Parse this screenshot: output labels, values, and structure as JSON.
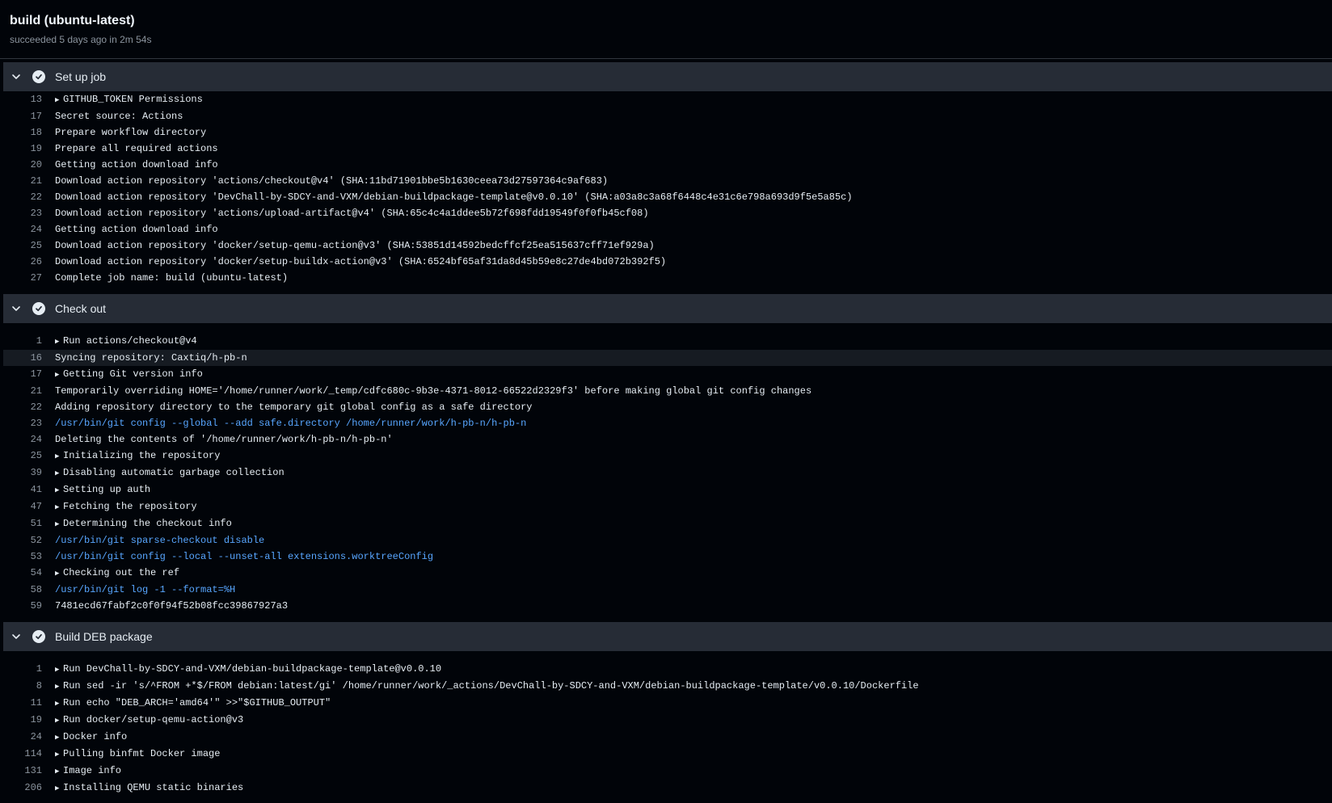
{
  "job": {
    "title": "build (ubuntu-latest)",
    "subtitle": "succeeded 5 days ago in 2m 54s"
  },
  "steps": [
    {
      "name": "Set up job",
      "lines": [
        {
          "n": "13",
          "t": "GITHUB_TOKEN Permissions",
          "group": true
        },
        {
          "n": "17",
          "t": "Secret source: Actions"
        },
        {
          "n": "18",
          "t": "Prepare workflow directory"
        },
        {
          "n": "19",
          "t": "Prepare all required actions"
        },
        {
          "n": "20",
          "t": "Getting action download info"
        },
        {
          "n": "21",
          "t": "Download action repository 'actions/checkout@v4' (SHA:11bd71901bbe5b1630ceea73d27597364c9af683)"
        },
        {
          "n": "22",
          "t": "Download action repository 'DevChall-by-SDCY-and-VXM/debian-buildpackage-template@v0.0.10' (SHA:a03a8c3a68f6448c4e31c6e798a693d9f5e5a85c)"
        },
        {
          "n": "23",
          "t": "Download action repository 'actions/upload-artifact@v4' (SHA:65c4c4a1ddee5b72f698fdd19549f0f0fb45cf08)"
        },
        {
          "n": "24",
          "t": "Getting action download info"
        },
        {
          "n": "25",
          "t": "Download action repository 'docker/setup-qemu-action@v3' (SHA:53851d14592bedcffcf25ea515637cff71ef929a)"
        },
        {
          "n": "26",
          "t": "Download action repository 'docker/setup-buildx-action@v3' (SHA:6524bf65af31da8d45b59e8c27de4bd072b392f5)"
        },
        {
          "n": "27",
          "t": "Complete job name: build (ubuntu-latest)"
        }
      ]
    },
    {
      "name": "Check out",
      "lines": [
        {
          "n": "1",
          "t": "Run actions/checkout@v4",
          "group": true
        },
        {
          "n": "16",
          "t": "Syncing repository: Caxtiq/h-pb-n",
          "hl": true
        },
        {
          "n": "17",
          "t": "Getting Git version info",
          "group": true
        },
        {
          "n": "21",
          "t": "Temporarily overriding HOME='/home/runner/work/_temp/cdfc680c-9b3e-4371-8012-66522d2329f3' before making global git config changes"
        },
        {
          "n": "22",
          "t": "Adding repository directory to the temporary git global config as a safe directory"
        },
        {
          "n": "23",
          "t": "/usr/bin/git config --global --add safe.directory /home/runner/work/h-pb-n/h-pb-n",
          "cmd": true
        },
        {
          "n": "24",
          "t": "Deleting the contents of '/home/runner/work/h-pb-n/h-pb-n'"
        },
        {
          "n": "25",
          "t": "Initializing the repository",
          "group": true
        },
        {
          "n": "39",
          "t": "Disabling automatic garbage collection",
          "group": true
        },
        {
          "n": "41",
          "t": "Setting up auth",
          "group": true
        },
        {
          "n": "47",
          "t": "Fetching the repository",
          "group": true
        },
        {
          "n": "51",
          "t": "Determining the checkout info",
          "group": true
        },
        {
          "n": "52",
          "t": "/usr/bin/git sparse-checkout disable",
          "cmd": true
        },
        {
          "n": "53",
          "t": "/usr/bin/git config --local --unset-all extensions.worktreeConfig",
          "cmd": true
        },
        {
          "n": "54",
          "t": "Checking out the ref",
          "group": true
        },
        {
          "n": "58",
          "t": "/usr/bin/git log -1 --format=%H",
          "cmd": true
        },
        {
          "n": "59",
          "t": "7481ecd67fabf2c0f0f94f52b08fcc39867927a3"
        }
      ]
    },
    {
      "name": "Build DEB package",
      "lines": [
        {
          "n": "1",
          "t": "Run DevChall-by-SDCY-and-VXM/debian-buildpackage-template@v0.0.10",
          "group": true
        },
        {
          "n": "8",
          "t": "Run sed -ir 's/^FROM +*$/FROM debian:latest/gi' /home/runner/work/_actions/DevChall-by-SDCY-and-VXM/debian-buildpackage-template/v0.0.10/Dockerfile",
          "group": true
        },
        {
          "n": "11",
          "t": "Run echo \"DEB_ARCH='amd64'\" >>\"$GITHUB_OUTPUT\"",
          "group": true
        },
        {
          "n": "19",
          "t": "Run docker/setup-qemu-action@v3",
          "group": true
        },
        {
          "n": "24",
          "t": "Docker info",
          "group": true
        },
        {
          "n": "114",
          "t": "Pulling binfmt Docker image",
          "group": true
        },
        {
          "n": "131",
          "t": "Image info",
          "group": true
        },
        {
          "n": "206",
          "t": "Installing QEMU static binaries",
          "group": true
        }
      ]
    }
  ]
}
